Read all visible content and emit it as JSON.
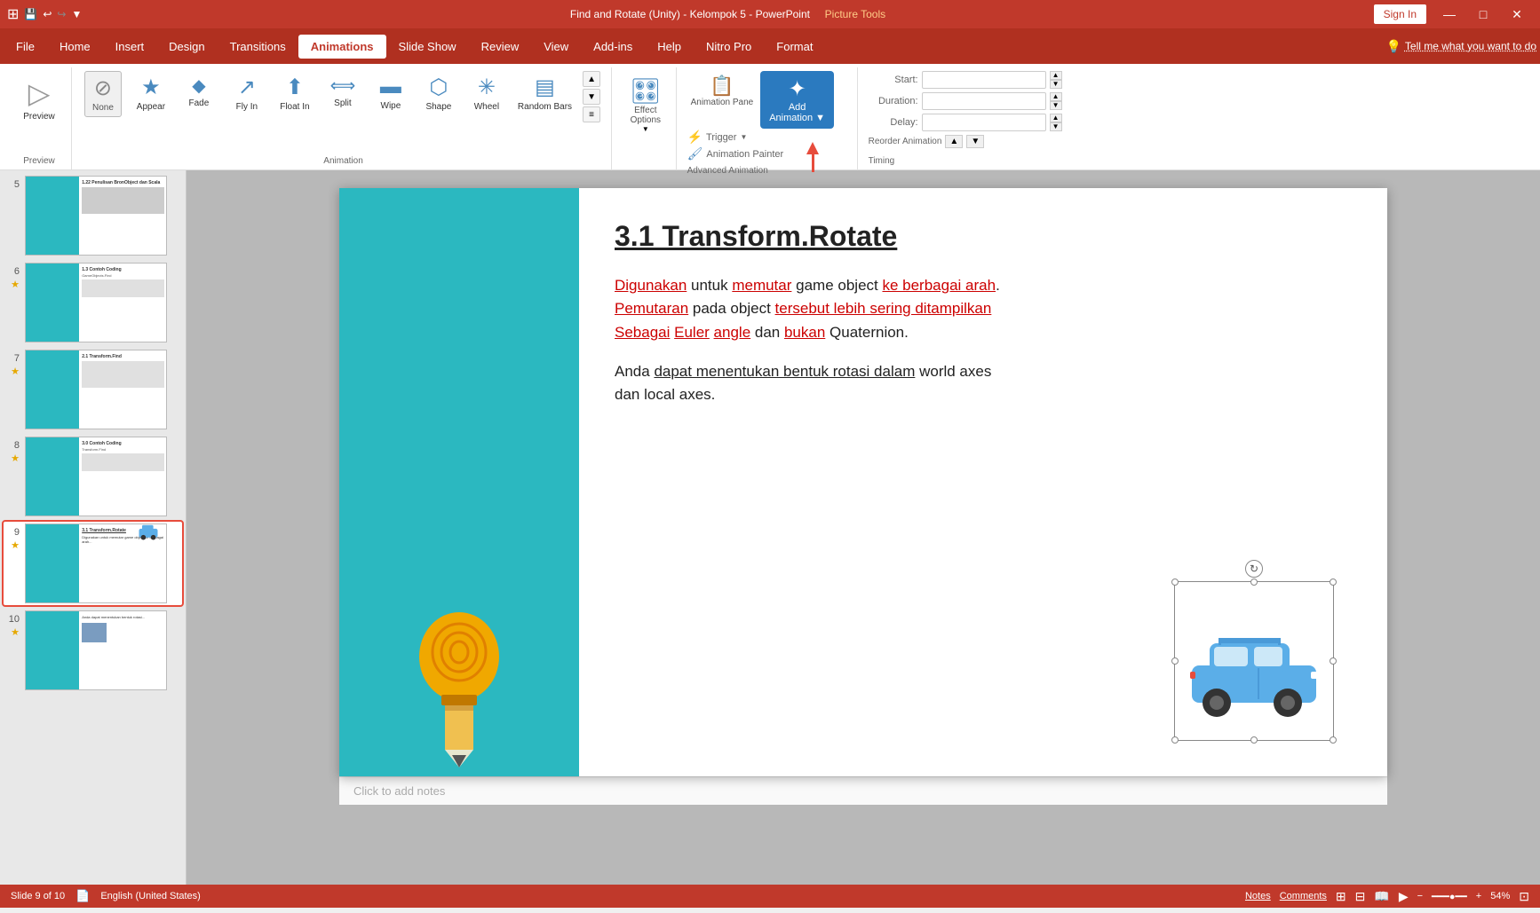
{
  "titlebar": {
    "title": "Find and Rotate (Unity) - Kelompok 5 - PowerPoint",
    "picture_tools": "Picture Tools",
    "sign_in": "Sign In"
  },
  "menubar": {
    "items": [
      {
        "label": "File",
        "active": false
      },
      {
        "label": "Home",
        "active": false
      },
      {
        "label": "Insert",
        "active": false
      },
      {
        "label": "Design",
        "active": false
      },
      {
        "label": "Transitions",
        "active": false
      },
      {
        "label": "Animations",
        "active": true
      },
      {
        "label": "Slide Show",
        "active": false
      },
      {
        "label": "Review",
        "active": false
      },
      {
        "label": "View",
        "active": false
      },
      {
        "label": "Add-ins",
        "active": false
      },
      {
        "label": "Help",
        "active": false
      },
      {
        "label": "Nitro Pro",
        "active": false
      },
      {
        "label": "Format",
        "active": false
      }
    ],
    "tell_me": "Tell me what you want to do"
  },
  "ribbon": {
    "preview_label": "Preview",
    "preview_btn": "Preview",
    "animation_label": "Animation",
    "none_label": "None",
    "animations": [
      {
        "label": "Appear",
        "icon": "★"
      },
      {
        "label": "Fade",
        "icon": "◆"
      },
      {
        "label": "Fly In",
        "icon": "▶"
      },
      {
        "label": "Float In",
        "icon": "▲"
      },
      {
        "label": "Split",
        "icon": "◀▶"
      },
      {
        "label": "Wipe",
        "icon": "▬"
      },
      {
        "label": "Shape",
        "icon": "⬡"
      },
      {
        "label": "Wheel",
        "icon": "✳"
      },
      {
        "label": "Random Bars",
        "icon": "▤"
      }
    ],
    "effect_options_label": "Effect Options",
    "advanced_animation_label": "Advanced Animation",
    "animation_pane_label": "Animation Pane",
    "trigger_label": "Trigger",
    "add_animation_label": "Add Animation",
    "animation_painter_label": "Animation Painter",
    "timing_label": "Timing",
    "start_label": "Start:",
    "duration_label": "Duration:",
    "delay_label": "Delay:",
    "reorder_label": "Reorder Animation"
  },
  "slides": [
    {
      "number": "5",
      "star": false,
      "thumb_text": "1.22 Penulisan BronObject dan Scala"
    },
    {
      "number": "6",
      "star": true,
      "thumb_text": "1.3 Contoh Coding GameObjects.Find"
    },
    {
      "number": "7",
      "star": true,
      "thumb_text": "2.1 Transform.Find"
    },
    {
      "number": "8",
      "star": true,
      "thumb_text": "3.0 Contoh Coding Transform.Find"
    },
    {
      "number": "9",
      "star": true,
      "thumb_text": "3.1 Transform.Rotate",
      "active": true
    },
    {
      "number": "10",
      "star": true,
      "thumb_text": ""
    }
  ],
  "slide": {
    "title": "3.1 Transform.Rotate",
    "body1": "Digunakan untuk memutar game object ke berbagai arah. Pemutaran pada object tersebut lebih sering ditampilkan Sebagai Euler angle dan bukan Quaternion.",
    "body2": "Anda dapat menentukan bentuk rotasi dalam world axes dan local axes.",
    "underlined_words": [
      "Digunakan",
      "memutar",
      "ke",
      "berbagai",
      "arah",
      "Pemutaran",
      "tersebut",
      "lebih",
      "sering",
      "ditampilkan",
      "Sebagai",
      "Euler",
      "angle",
      "bukan"
    ]
  },
  "statusbar": {
    "slide_info": "Slide 9 of 10",
    "language": "English (United States)",
    "notes_label": "Notes",
    "comments_label": "Comments"
  },
  "notes_placeholder": "Click to add notes"
}
